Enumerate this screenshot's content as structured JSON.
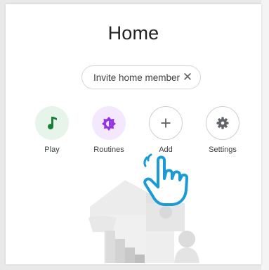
{
  "header": {
    "title": "Home"
  },
  "invite_chip": {
    "label": "Invite home member",
    "close_icon": "close-icon"
  },
  "actions": [
    {
      "label": "Play",
      "icon": "music-note-icon",
      "bg": "#e6f4ea",
      "fg": "#188038"
    },
    {
      "label": "Routines",
      "icon": "sun-icon",
      "bg": "#f3e8fd",
      "fg": "#9334e6"
    },
    {
      "label": "Add",
      "icon": "plus-icon",
      "bg": "#ffffff",
      "fg": "#5f6368"
    },
    {
      "label": "Settings",
      "icon": "gear-icon",
      "bg": "#ffffff",
      "fg": "#5f6368"
    }
  ],
  "overlay": {
    "icon": "pointing-hand-icon",
    "color": "#1a9bd7"
  },
  "illustration": {
    "icon": "home-illustration"
  }
}
